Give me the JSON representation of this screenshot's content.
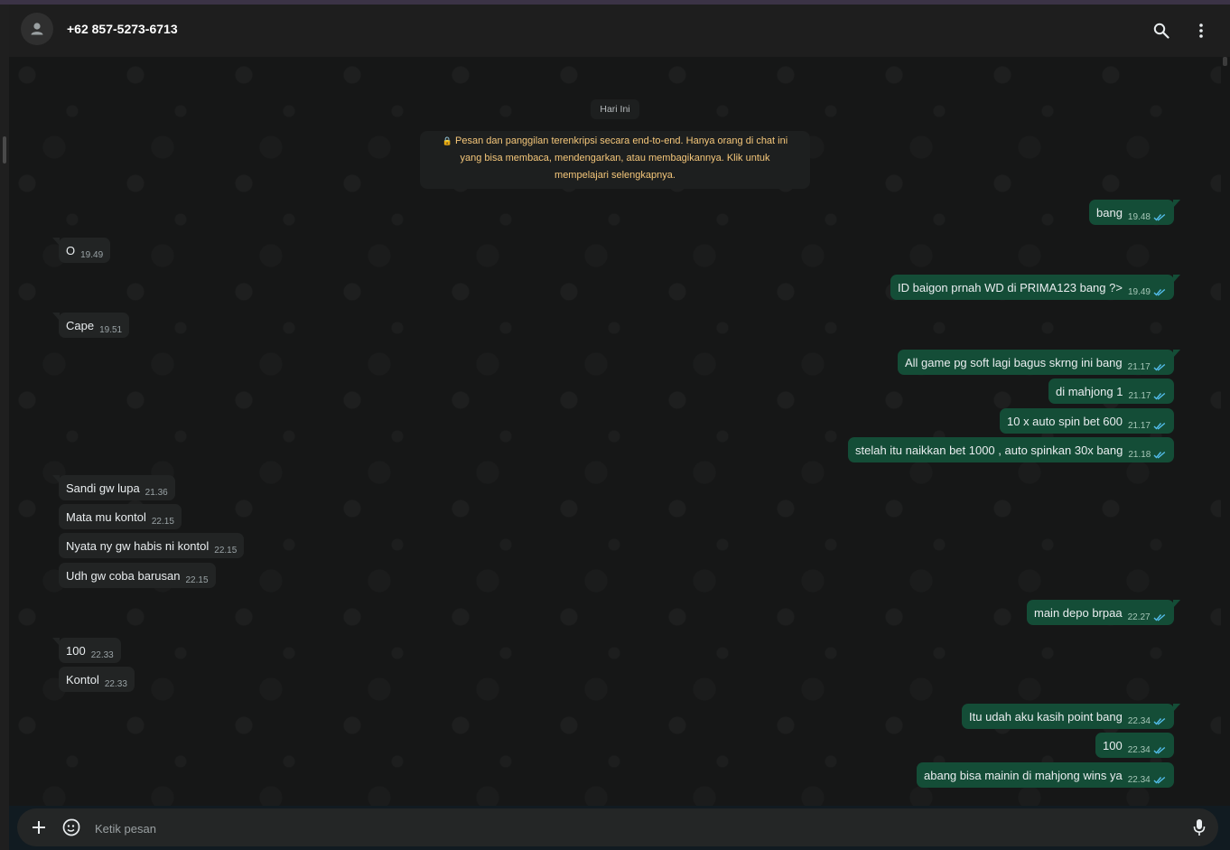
{
  "header": {
    "contact_name": "+62 857-5273-6713",
    "avatar_icon": "person-icon",
    "search_icon": "search-icon",
    "menu_icon": "more-vertical-icon"
  },
  "chat": {
    "date_label": "Hari Ini",
    "encryption_notice": {
      "icon": "lock-icon",
      "line1": "Pesan dan panggilan terenkripsi secara end-to-end. Hanya orang di chat ini",
      "line2": "yang bisa membaca, mendengarkan, atau membagikannya. Klik untuk",
      "line3": "mempelajari selengkapnya."
    },
    "messages": [
      {
        "dir": "out",
        "text": "bang",
        "time": "19.48",
        "status": "read"
      },
      {
        "dir": "in",
        "text": "O",
        "time": "19.49"
      },
      {
        "dir": "out",
        "text": "ID baigon prnah WD di PRIMA123 bang ?>",
        "time": "19.49",
        "status": "read"
      },
      {
        "dir": "in",
        "text": "Cape",
        "time": "19.51"
      },
      {
        "dir": "out",
        "text": "All game pg soft lagi bagus skrng ini bang",
        "time": "21.17",
        "status": "read"
      },
      {
        "dir": "out",
        "text": "di mahjong 1",
        "time": "21.17",
        "status": "read"
      },
      {
        "dir": "out",
        "text": "10 x auto spin bet 600",
        "time": "21.17",
        "status": "read"
      },
      {
        "dir": "out",
        "text": "stelah itu naikkan bet 1000 , auto spinkan 30x bang",
        "time": "21.18",
        "status": "read"
      },
      {
        "dir": "in",
        "text": "Sandi gw lupa",
        "time": "21.36"
      },
      {
        "dir": "in",
        "text": "Mata mu kontol",
        "time": "22.15"
      },
      {
        "dir": "in",
        "text": "Nyata ny gw habis ni kontol",
        "time": "22.15"
      },
      {
        "dir": "in",
        "text": "Udh gw coba barusan",
        "time": "22.15"
      },
      {
        "dir": "out",
        "text": "main depo brpaa",
        "time": "22.27",
        "status": "read"
      },
      {
        "dir": "in",
        "text": "100",
        "time": "22.33"
      },
      {
        "dir": "in",
        "text": "Kontol",
        "time": "22.33"
      },
      {
        "dir": "out",
        "text": "Itu udah aku kasih point bang",
        "time": "22.34",
        "status": "read"
      },
      {
        "dir": "out",
        "text": "100",
        "time": "22.34",
        "status": "read"
      },
      {
        "dir": "out",
        "text": "abang bisa mainin di mahjong wins ya",
        "time": "22.34",
        "status": "read"
      }
    ],
    "colors": {
      "background": "#161717",
      "bubble_in": "#222424",
      "bubble_out": "#144d37",
      "read_ticks": "#53bdeb",
      "notice_text": "#f5c77a"
    }
  },
  "composer": {
    "placeholder": "Ketik pesan",
    "attach_icon": "plus-icon",
    "sticker_icon": "sticker-icon",
    "mic_icon": "microphone-icon"
  }
}
